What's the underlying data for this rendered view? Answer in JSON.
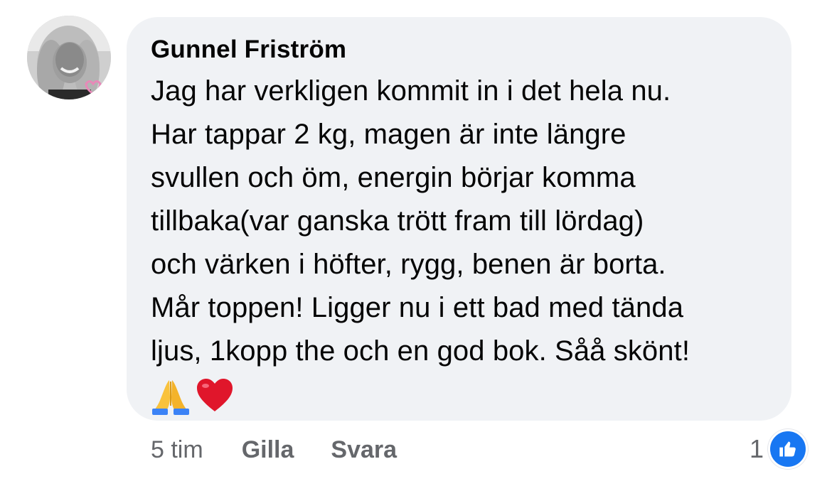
{
  "comment": {
    "author": "Gunnel Friström",
    "text": "Jag har verkligen kommit in i det hela nu.\nHar tappar 2 kg, magen är inte längre\nsvullen och öm, energin börjar komma\ntillbaka(var ganska trött fram till lördag)\noch värken i höfter, rygg, benen är borta.\nMår toppen! Ligger nu i ett bad med tända\nljus, 1kopp the och en god bok. Såå skönt!",
    "emojis": [
      "folded-hands",
      "red-heart"
    ]
  },
  "actions": {
    "time": "5 tim",
    "like_label": "Gilla",
    "reply_label": "Svara"
  },
  "reactions": {
    "count": "1",
    "icon": "like-icon",
    "color": "#1877f2"
  },
  "colors": {
    "bubble_bg": "#f0f2f5",
    "secondary_text": "#65676b",
    "primary_text": "#050505",
    "heart": "#e0162b",
    "like_blue": "#1877f2"
  }
}
